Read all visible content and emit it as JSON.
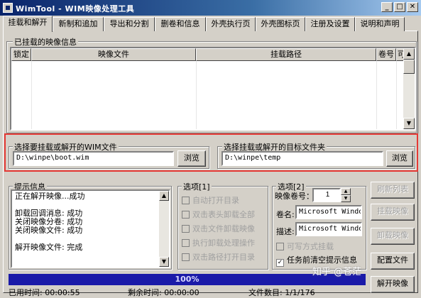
{
  "window": {
    "title": "WimTool - WIM映像处理工具"
  },
  "tabs": [
    "挂载和解开",
    "新制和追加",
    "导出和分割",
    "删卷和信息",
    "外壳执行页",
    "外壳图标页",
    "注册及设置",
    "说明和声明"
  ],
  "mounted": {
    "group_label": "已挂载的映像信息",
    "columns": [
      "锁定",
      "映像文件",
      "挂载路径",
      "卷号",
      "可写"
    ]
  },
  "wim_file": {
    "label": "选择要挂载或解开的WIM文件",
    "value": "D:\\winpe\\boot.wim",
    "browse": "浏览"
  },
  "target_dir": {
    "label": "选择挂载或解开的目标文件夹",
    "value": "D:\\winpe\\temp",
    "browse": "浏览"
  },
  "info": {
    "label": "提示信息",
    "text": "正在解开映像...成功\n\n卸载回调消息: 成功\n关闭映像分卷: 成功\n关闭映像文件: 成功\n\n解开映像文件: 完成"
  },
  "options1": {
    "label": "选项[1]",
    "items": [
      "自动打开目录",
      "双击表头卸载全部",
      "双击文件卸载映像",
      "执行卸载处理操作",
      "双击路径打开目录"
    ]
  },
  "options2": {
    "label": "选项[2]",
    "volume_label": "映像卷号：",
    "volume_value": "1",
    "name_label": "卷名:",
    "name_value": "Microsoft Windo",
    "desc_label": "描述:",
    "desc_value": "Microsoft Windo",
    "writable_label": "可写方式挂载",
    "clear_label": "任务前清空提示信息",
    "clear_checked": true
  },
  "buttons": {
    "refresh": "刷新列表",
    "mount": "挂载映像",
    "unmount": "卸载映像",
    "config": "配置文件",
    "extract": "解开映像"
  },
  "progress": {
    "text": "100%",
    "value": 1.0
  },
  "status": {
    "elapsed": "已用时间: 00:00:55",
    "remaining": "剩余时间: 00:00:00",
    "files": "文件数目: 1/1/176"
  },
  "watermark": "知乎 @苍茫",
  "colors": {
    "title_start": "#0a246a",
    "title_end": "#a6caf0",
    "progress": "#1a1aa8",
    "highlight": "#e53935"
  }
}
